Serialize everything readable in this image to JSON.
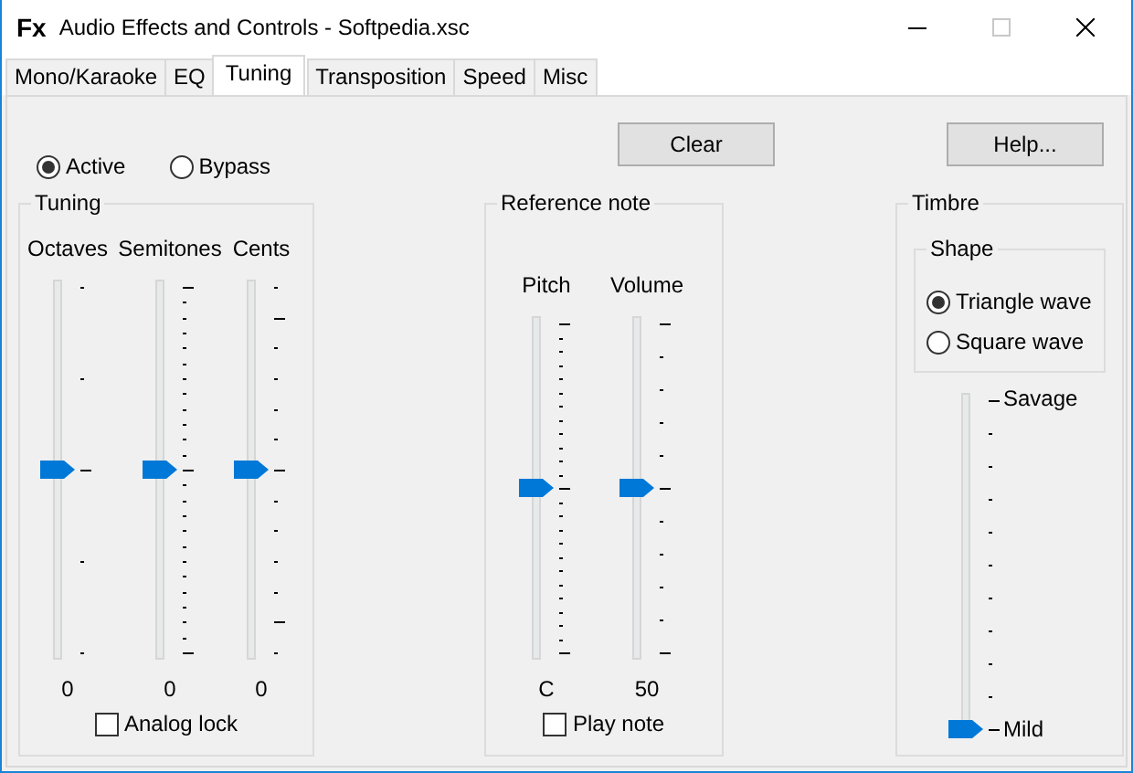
{
  "window": {
    "icon": "Fx",
    "title": "Audio Effects and Controls - Softpedia.xsc"
  },
  "tabs": [
    {
      "label": "Mono/Karaoke",
      "selected": false
    },
    {
      "label": "EQ",
      "selected": false
    },
    {
      "label": "Tuning",
      "selected": true
    },
    {
      "label": "Transposition",
      "selected": false
    },
    {
      "label": "Speed",
      "selected": false
    },
    {
      "label": "Misc",
      "selected": false
    }
  ],
  "mode": [
    {
      "label": "Active",
      "selected": true
    },
    {
      "label": "Bypass",
      "selected": false
    }
  ],
  "buttons": [
    "Clear",
    "Help..."
  ],
  "tuning": {
    "title": "Tuning",
    "sliders": [
      {
        "label": "Octaves",
        "level": 0.5,
        "reading": "0"
      },
      {
        "label": "Semitones",
        "level": 0.5,
        "reading": "0"
      },
      {
        "label": "Cents",
        "level": 0.5,
        "reading": "0"
      }
    ],
    "analog_lock": {
      "label": "Analog lock",
      "checked": false
    }
  },
  "reference_note": {
    "title": "Reference note",
    "sliders": [
      {
        "label": "Pitch",
        "level": 0.5,
        "reading": "C"
      },
      {
        "label": "Volume",
        "level": 0.5,
        "reading": "50"
      }
    ],
    "play_note": {
      "label": "Play note",
      "checked": false
    }
  },
  "timbre": {
    "title": "Timbre",
    "shape": {
      "title": "Shape",
      "options": [
        {
          "label": "Triangle wave",
          "selected": true
        },
        {
          "label": "Square wave",
          "selected": false
        }
      ]
    },
    "slider": {
      "level": 0,
      "top_label": "Savage",
      "bottom_label": "Mild"
    }
  }
}
